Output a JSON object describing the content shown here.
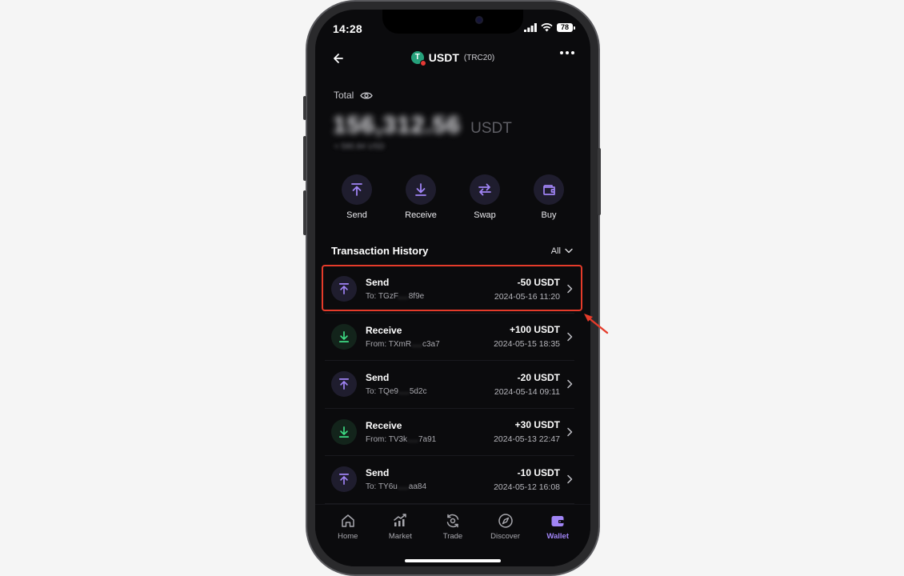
{
  "status_bar": {
    "time": "14:28",
    "battery": "78"
  },
  "header": {
    "title": "USDT",
    "network": "(TRC20)",
    "token_symbol": "T"
  },
  "balance": {
    "label": "Total",
    "amount": "156,312.56",
    "unit": "USDT",
    "fiat": "≈ 580.84 USD"
  },
  "actions": [
    {
      "label": "Send",
      "icon": "arrow-up-to-line-icon"
    },
    {
      "label": "Receive",
      "icon": "arrow-down-to-line-icon"
    },
    {
      "label": "Swap",
      "icon": "swap-arrows-icon"
    },
    {
      "label": "Buy",
      "icon": "wallet-card-icon"
    }
  ],
  "history": {
    "title": "Transaction History",
    "filter": "All",
    "transactions": [
      {
        "type": "Send",
        "dir_label": "To:",
        "addr_start": "TGzF",
        "addr_end": "8f9e",
        "amount": "-50 USDT",
        "date": "2024-05-16 11:20"
      },
      {
        "type": "Receive",
        "dir_label": "From:",
        "addr_start": "TXmR",
        "addr_end": "c3a7",
        "amount": "+100 USDT",
        "date": "2024-05-15 18:35"
      },
      {
        "type": "Send",
        "dir_label": "To:",
        "addr_start": "TQe9",
        "addr_end": "5d2c",
        "amount": "-20 USDT",
        "date": "2024-05-14 09:11"
      },
      {
        "type": "Receive",
        "dir_label": "From:",
        "addr_start": "TV3k",
        "addr_end": "7a91",
        "amount": "+30 USDT",
        "date": "2024-05-13 22:47"
      },
      {
        "type": "Send",
        "dir_label": "To:",
        "addr_start": "TY6u",
        "addr_end": "aa84",
        "amount": "-10 USDT",
        "date": "2024-05-12 16:08"
      }
    ]
  },
  "tabbar": {
    "tabs": [
      {
        "label": "Home",
        "icon": "home-icon"
      },
      {
        "label": "Market",
        "icon": "market-chart-icon"
      },
      {
        "label": "Trade",
        "icon": "trade-icon"
      },
      {
        "label": "Discover",
        "icon": "compass-icon"
      },
      {
        "label": "Wallet",
        "icon": "wallet-icon"
      }
    ],
    "active": "Wallet"
  },
  "colors": {
    "accent": "#a084f5",
    "receive": "#3ddc84",
    "highlight": "#e53b2a",
    "tether": "#26a17b"
  }
}
